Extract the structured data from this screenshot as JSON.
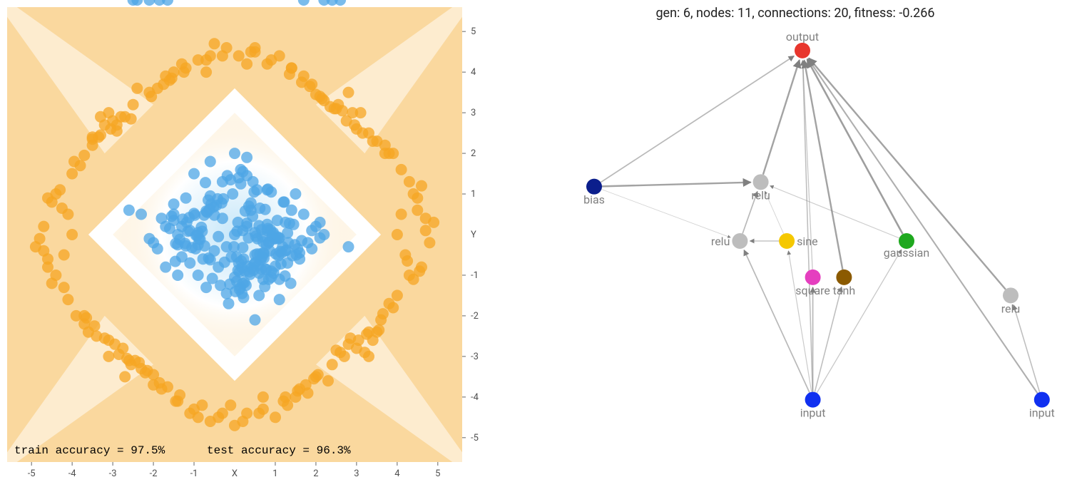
{
  "chart_data": [
    {
      "type": "scatter",
      "title": "",
      "xlabel": "X",
      "ylabel": "Y",
      "xlim": [
        -5.6,
        5.6
      ],
      "ylim": [
        -5.6,
        5.6
      ],
      "x_ticks": [
        -5,
        -4,
        -3,
        -2,
        -1,
        1,
        2,
        3,
        4,
        5
      ],
      "y_ticks": [
        -5,
        -4,
        -3,
        -2,
        -1,
        1,
        2,
        3,
        4,
        5
      ],
      "accuracy_text_train": "train accuracy = 97.5%",
      "accuracy_text_test": "test accuracy = 96.3%",
      "background_regions": "diamond-decision-boundary",
      "colors": {
        "class_a": "#4DA6E6",
        "class_b": "#F5A623",
        "bg_a": "#BEE3F8",
        "bg_b": "#FAD89E"
      },
      "series": [
        {
          "name": "class_blue_inner",
          "color": "#4DA6E6",
          "shape": "circle",
          "x": [
            0,
            0.3,
            -0.5,
            1.2,
            -1.1,
            0.8,
            -0.9,
            0.4,
            -0.2,
            1.5,
            -1.7,
            2.1,
            -2.0,
            0.1,
            0.6,
            -0.6,
            1.9,
            -1.4,
            0.2,
            -0.3,
            0.9,
            -1.2,
            1.6,
            -1.8,
            0.7,
            2.2,
            -2.3,
            2.8,
            -2.6,
            0.0,
            0.5,
            1.1,
            -1.0,
            -0.7,
            0.3,
            -0.4,
            1.3,
            -1.5,
            1.7,
            -1.9,
            2.0,
            -2.1,
            0.05,
            0.2,
            -0.15,
            0.9,
            0.6,
            -0.6,
            1.0,
            -1.1,
            1.4,
            -1.3,
            -0.9,
            0.8,
            -0.2,
            0.3,
            -0.35,
            1.25,
            -1.2,
            0.15,
            1.8,
            -1.7,
            2.1,
            0.0,
            0.7,
            -0.75,
            0.35,
            -0.25,
            1.05,
            -1.05,
            0.55,
            -0.55,
            0.25,
            1.35,
            -1.4,
            1.6,
            -1.55,
            0.45,
            0.95,
            -0.95,
            0.12,
            -0.1,
            0.65,
            -0.65,
            1.1,
            -1.15,
            0.22,
            0.82,
            -0.85,
            1.25,
            0.32,
            -0.32,
            0.05,
            1.45,
            -1.45,
            0.72,
            -0.7,
            0.18,
            -0.18,
            0.92,
            0.48,
            -0.45,
            -0.28,
            0.08,
            1.55,
            -1.5,
            0.62,
            -0.6,
            0.28,
            0.85,
            -0.82,
            1.08,
            -1.0,
            0.38,
            0.15,
            -0.12,
            0.98,
            0.55,
            -0.5,
            0.75,
            -0.78,
            1.18,
            -1.18,
            0.42,
            0.02,
            1.65,
            -1.6,
            0.68,
            -0.68,
            0.24,
            0.88,
            -0.88,
            1.12,
            -1.12,
            -0.05,
            0.52,
            -0.52,
            0.78,
            0.36,
            1.28,
            -1.28,
            0.58,
            -0.58,
            0.14,
            0.94,
            -0.92,
            1.02,
            -0.98,
            0.46,
            -0.42,
            1.32,
            -1.3,
            0.64,
            -0.62,
            0.2,
            0.84,
            -0.8,
            1.06,
            0.5,
            0.76,
            -0.74,
            0.3,
            0.1,
            1.38,
            -1.35,
            0.66,
            -0.64,
            0.26,
            0.9,
            -0.9,
            1.16,
            0.44,
            -0.4,
            1.22,
            -1.22,
            0.6,
            0.16,
            0.96,
            -0.96,
            1.0,
            0.4,
            0.74,
            -0.72,
            0.34,
            0.06,
            1.42,
            -1.4,
            0.7,
            0.22,
            0.86,
            1.14,
            0.48,
            1.24,
            0.56,
            0.8,
            -0.08,
            0.12,
            1.48,
            -1.46,
            0.72,
            0.18,
            0.82,
            1.1,
            0.52,
            1.3,
            0.62,
            0.78,
            -0.02,
            0.08,
            1.52,
            -1.5,
            0.68,
            0.2,
            0.84,
            1.08,
            0.5,
            -0.3,
            1.9,
            -1.85,
            2.2,
            -2.1,
            2.4,
            -2.4,
            2.6,
            -2.5,
            1.7,
            -1.65
          ],
          "y": [
            0,
            0.2,
            -0.4,
            0.8,
            -0.7,
            1.1,
            -1.0,
            0.6,
            -0.3,
            1.0,
            -0.8,
            0.3,
            -0.2,
            1.4,
            -1.5,
            1.8,
            0.1,
            0.0,
            -1.2,
            1.3,
            -0.9,
            0.9,
            -0.6,
            0.4,
            -1.1,
            0.0,
            0.5,
            -0.3,
            0.6,
            2.0,
            -2.1,
            -1.6,
            1.5,
            -1.3,
            1.9,
            -0.05,
            -0.7,
            0.75,
            0.5,
            -0.35,
            0.2,
            -0.1,
            -0.55,
            1.55,
            -1.7,
            1.05,
            -0.95,
            0.95,
            -0.1,
            0.1,
            0.6,
            -0.55,
            -0.25,
            0.25,
            -1.45,
            1.45,
            -1.25,
            0.3,
            -0.28,
            1.6,
            -0.2,
            0.2,
            -0.08,
            -1.05,
            -0.45,
            0.48,
            0.7,
            -0.68,
            0.35,
            -0.32,
            1.1,
            -1.08,
            -0.9,
            0.28,
            -0.25,
            -0.45,
            0.45,
            1.3,
            0.05,
            -0.02,
            -1.35,
            1.35,
            -0.85,
            0.85,
            -0.08,
            0.08,
            -1.55,
            0.15,
            -0.12,
            -0.4,
            -0.78,
            0.78,
            -1.15,
            0.25,
            -0.22,
            -0.58,
            0.58,
            -1.45,
            1.45,
            -0.05,
            -0.72,
            0.72,
            0.88,
            -0.88,
            -0.35,
            0.35,
            0.65,
            -0.62,
            -1.25,
            -0.18,
            0.18,
            -0.52,
            0.52,
            -0.98,
            1.25,
            -1.22,
            -0.1,
            -0.48,
            0.48,
            0.62,
            -0.6,
            -0.3,
            0.3,
            -0.82,
            -1.4,
            -0.15,
            0.15,
            -0.55,
            0.55,
            -1.18,
            0.12,
            -0.1,
            -0.42,
            0.42,
            1.0,
            -0.68,
            0.68,
            -0.25,
            -0.92,
            -0.38,
            0.38,
            -0.75,
            0.75,
            -1.3,
            0.02,
            -0.02,
            -0.48,
            0.48,
            -0.88,
            0.88,
            -0.2,
            0.2,
            -0.62,
            0.62,
            -0.32,
            -1.1,
            0.08,
            -0.06,
            -0.5,
            -0.85,
            -0.28,
            0.28,
            -0.7,
            -1.2,
            -0.12,
            0.12,
            -0.58,
            0.58,
            -1.05,
            0.05,
            -0.45,
            0.45,
            -0.8,
            0.8,
            -0.22,
            0.22,
            -0.65,
            -0.95,
            -0.35,
            -0.78,
            0.78,
            -1.28,
            1.28,
            -0.08,
            0.08,
            -0.52,
            -1.0,
            -0.18,
            -0.6,
            -0.4,
            -0.72,
            1.05,
            -1.02,
            -0.1,
            0.1,
            -0.55,
            -0.92,
            -0.25,
            -0.66,
            -0.46,
            -0.82,
            1.12,
            -1.1,
            -0.04,
            0.04,
            -0.48,
            -0.86,
            -0.3,
            0.3,
            -0.5,
            0.5,
            -0.05,
            0.1,
            -0.2,
            -0.1,
            0.05,
            0.4,
            -0.35
          ]
        },
        {
          "name": "class_orange_outer",
          "color": "#F5A623",
          "shape": "circle",
          "x": [
            -4.1,
            4.2,
            3.8,
            -3.7,
            4.6,
            -4.5,
            -3.1,
            3.3,
            2.8,
            -2.7,
            0.1,
            -0.3,
            0.5,
            -0.6,
            4.0,
            -4.0,
            1.4,
            -1.45,
            1.0,
            -0.9,
            4.3,
            -4.4,
            2.3,
            -2.4,
            3.0,
            -3.0,
            -0.1,
            0.3,
            0.7,
            -0.7,
            -4.2,
            4.1,
            -3.5,
            3.6,
            -4.6,
            4.5,
            1.8,
            -1.7,
            2.1,
            -2.2,
            -4.3,
            4.4,
            -3.2,
            3.4,
            -4.7,
            4.8,
            0.9,
            -1.0,
            1.2,
            -1.2,
            -4.5,
            4.6,
            -3.9,
            3.9,
            -4.1,
            4.1,
            2.4,
            -2.5,
            2.7,
            -2.8,
            -0.4,
            0.4,
            0.8,
            -0.8,
            -3.6,
            3.5,
            -4.8,
            4.7,
            1.5,
            -1.5,
            1.9,
            -2.0,
            -3.3,
            3.2,
            -4.2,
            4.3,
            2.0,
            -2.1,
            2.5,
            -2.6,
            -0.2,
            0.2,
            0.6,
            -0.6,
            -3.8,
            3.8,
            -4.9,
            4.9,
            1.1,
            -1.1,
            1.3,
            -1.3,
            -3.4,
            3.3,
            -4.0,
            4.0,
            2.2,
            -2.3,
            2.6,
            -2.7,
            0.0,
            -0.5,
            0.5,
            -0.9,
            -3.7,
            3.7,
            -4.4,
            4.4,
            1.6,
            -1.6,
            1.7,
            -1.8,
            -3.1,
            3.1,
            -4.6,
            4.5,
            2.8,
            -2.9,
            3.0,
            -3.1,
            -0.3,
            0.3,
            0.7,
            -0.7,
            -3.5,
            3.5,
            -4.7,
            4.7,
            1.4,
            -1.4,
            2.9,
            -2.85,
            3.4,
            -3.45,
            3.7,
            -3.65,
            -1.9,
            1.95,
            -2.05,
            2.05,
            -2.45,
            2.45,
            3.15,
            -3.2,
            3.55,
            -3.5,
            -2.55,
            2.55,
            -2.75,
            2.75,
            3.05,
            -3.05,
            3.25,
            -3.3,
            -2.65,
            2.65,
            -2.95,
            2.95,
            3.65,
            -3.7,
            3.9,
            -3.95,
            -2.15,
            2.15,
            -2.35,
            2.35,
            2.85,
            -2.9,
            3.3,
            -3.35,
            -1.85,
            1.85,
            -2.0,
            2.0,
            2.5,
            -2.55,
            -1.25,
            1.25,
            -1.55,
            1.55,
            -1.75,
            1.75,
            4.25,
            -4.25,
            4.55,
            -4.6,
            -1.35,
            1.35,
            -1.65,
            1.65
          ],
          "y": [
            0.5,
            -0.5,
            2.0,
            -2.0,
            1.2,
            -1.2,
            3.0,
            -3.0,
            3.5,
            -3.5,
            4.4,
            -4.4,
            4.6,
            -4.6,
            0.0,
            0.0,
            4.1,
            -4.1,
            -4.5,
            4.3,
            -1.0,
            1.0,
            -3.6,
            3.6,
            -2.8,
            2.8,
            -4.2,
            4.2,
            -4.0,
            4.0,
            -0.5,
            0.5,
            2.2,
            -2.1,
            -0.8,
            0.9,
            -3.9,
            3.9,
            3.4,
            -3.4,
            1.1,
            -1.1,
            2.7,
            -2.6,
            0.2,
            -0.2,
            4.3,
            -4.3,
            -4.1,
            4.1,
            0.8,
            -0.8,
            -2.0,
            2.0,
            -1.6,
            1.6,
            -3.2,
            3.2,
            -3.0,
            2.9,
            -4.5,
            4.5,
            4.2,
            -4.2,
            -2.4,
            2.3,
            -0.1,
            0.1,
            -4.0,
            4.0,
            3.7,
            -3.7,
            2.9,
            -2.9,
            -1.3,
            1.3,
            -3.5,
            3.5,
            3.1,
            -3.1,
            4.6,
            -4.6,
            -4.4,
            4.4,
            1.7,
            -1.7,
            -0.3,
            0.3,
            4.4,
            -4.4,
            -4.2,
            4.2,
            -2.5,
            2.5,
            1.5,
            -1.5,
            3.3,
            -3.3,
            -2.9,
            2.9,
            -4.7,
            4.7,
            4.5,
            -4.5,
            -2.2,
            2.2,
            -1.0,
            1.0,
            -3.8,
            3.8,
            3.9,
            -3.8,
            -3.0,
            3.0,
            -0.6,
            0.6,
            -2.7,
            2.7,
            2.6,
            -2.6,
            4.4,
            -4.4,
            -4.3,
            4.3,
            2.4,
            -2.4,
            -0.4,
            0.4,
            4.1,
            -4.1,
            3.0,
            -2.95,
            2.3,
            -2.25,
            2.0,
            -2.05,
            3.6,
            -3.55,
            3.4,
            -3.45,
            -3.1,
            3.1,
            2.5,
            -2.55,
            -2.35,
            2.35,
            -3.2,
            3.2,
            -2.8,
            2.8,
            -2.6,
            2.6,
            -2.45,
            2.45,
            -3.05,
            3.05,
            -2.7,
            2.7,
            -1.95,
            1.95,
            -1.8,
            1.8,
            -3.35,
            3.35,
            -3.15,
            3.15,
            -2.55,
            2.55,
            -2.4,
            2.4,
            -3.65,
            3.65,
            -3.45,
            3.45,
            -2.85,
            2.85,
            4.0,
            -4.0,
            3.85,
            -3.85,
            3.7,
            -3.7,
            -0.65,
            0.65,
            -0.9,
            0.9,
            -3.95,
            3.95,
            -3.75,
            3.75
          ]
        }
      ]
    },
    {
      "type": "network-graph",
      "title_fmt": "gen: {gen}, nodes: {nodes}, connections: {connections}, fitness: {fitness}",
      "gen": 6,
      "nodes_count": 11,
      "connections_count": 20,
      "fitness": -0.266,
      "nodes": [
        {
          "id": "output",
          "label": "output",
          "x": 0.5,
          "y": 0.08,
          "color": "#E8362D"
        },
        {
          "id": "bias",
          "label": "bias",
          "x": 0.1,
          "y": 0.38,
          "color": "#0B1E8C"
        },
        {
          "id": "relu1",
          "label": "relu",
          "x": 0.42,
          "y": 0.37,
          "color": "#BDBDBD"
        },
        {
          "id": "relu2",
          "label": "relu",
          "x": 0.38,
          "y": 0.5,
          "color": "#BDBDBD"
        },
        {
          "id": "sine",
          "label": "sine",
          "x": 0.47,
          "y": 0.5,
          "color": "#F5C800"
        },
        {
          "id": "square",
          "label": "square",
          "x": 0.52,
          "y": 0.58,
          "color": "#E53FBF"
        },
        {
          "id": "tanh",
          "label": "tanh",
          "x": 0.58,
          "y": 0.58,
          "color": "#8B5A00"
        },
        {
          "id": "gaussian",
          "label": "gaussian",
          "x": 0.7,
          "y": 0.5,
          "color": "#1EA81E"
        },
        {
          "id": "relu3",
          "label": "relu",
          "x": 0.9,
          "y": 0.62,
          "color": "#BDBDBD"
        },
        {
          "id": "input1",
          "label": "input",
          "x": 0.52,
          "y": 0.85,
          "color": "#1030F0"
        },
        {
          "id": "input2",
          "label": "input",
          "x": 0.96,
          "y": 0.85,
          "color": "#1030F0"
        }
      ],
      "edges": [
        {
          "from": "bias",
          "to": "output",
          "w": 0.35
        },
        {
          "from": "bias",
          "to": "relu1",
          "w": 0.55
        },
        {
          "from": "bias",
          "to": "relu2",
          "w": 0.12
        },
        {
          "from": "relu1",
          "to": "output",
          "w": 0.55
        },
        {
          "from": "relu2",
          "to": "relu1",
          "w": 0.35
        },
        {
          "from": "sine",
          "to": "relu1",
          "w": 0.12
        },
        {
          "from": "sine",
          "to": "relu2",
          "w": 0.25
        },
        {
          "from": "square",
          "to": "output",
          "w": 0.22
        },
        {
          "from": "tanh",
          "to": "output",
          "w": 0.55
        },
        {
          "from": "gaussian",
          "to": "output",
          "w": 0.6
        },
        {
          "from": "gaussian",
          "to": "relu1",
          "w": 0.18
        },
        {
          "from": "relu3",
          "to": "output",
          "w": 0.55
        },
        {
          "from": "input1",
          "to": "relu2",
          "w": 0.35
        },
        {
          "from": "input1",
          "to": "sine",
          "w": 0.2
        },
        {
          "from": "input1",
          "to": "square",
          "w": 0.35
        },
        {
          "from": "input1",
          "to": "tanh",
          "w": 0.3
        },
        {
          "from": "input1",
          "to": "gaussian",
          "w": 0.22
        },
        {
          "from": "input1",
          "to": "output",
          "w": 0.3
        },
        {
          "from": "input2",
          "to": "relu3",
          "w": 0.3
        },
        {
          "from": "input2",
          "to": "output",
          "w": 0.45
        }
      ]
    }
  ]
}
